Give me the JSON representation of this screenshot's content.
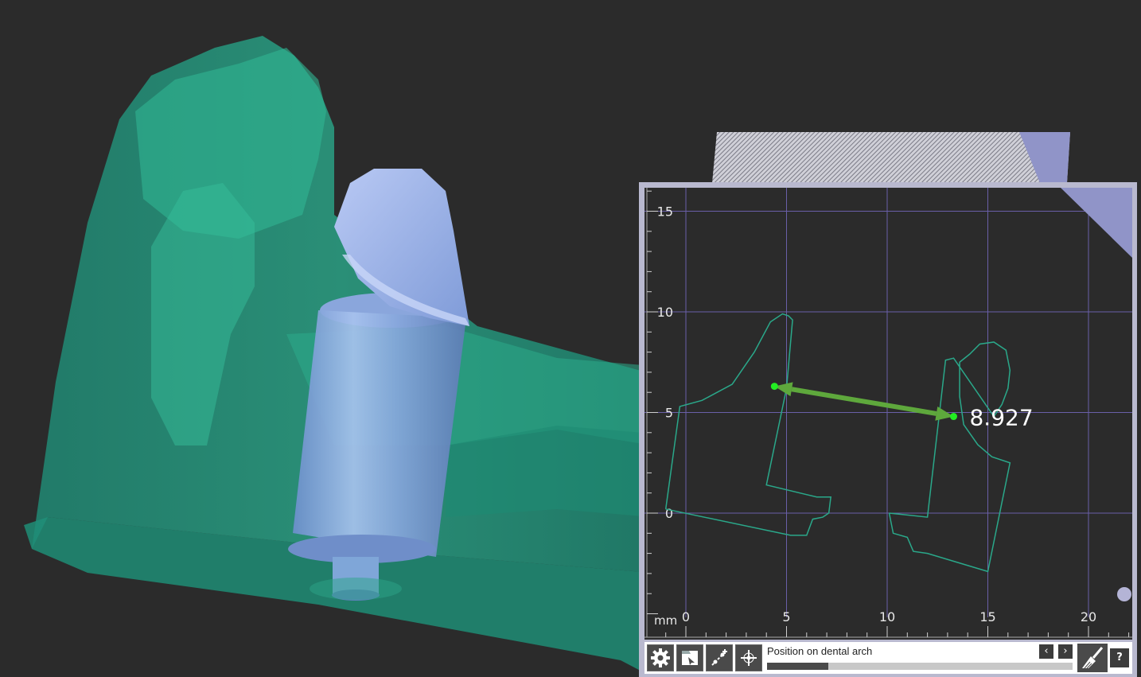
{
  "scene": {
    "model_color": "#2aa88a",
    "abutment_color": "#7f9fd8",
    "background_color": "#2b2b2b"
  },
  "chart_data": {
    "type": "cross-section",
    "unit_label": "mm",
    "x_ticks": [
      0,
      5,
      10,
      15,
      20
    ],
    "y_ticks": [
      0,
      5,
      10,
      15
    ],
    "xlim": [
      -1,
      23
    ],
    "ylim": [
      -5,
      16
    ],
    "grid": true,
    "outline_color": "#2aa88a",
    "measurement": {
      "label": "8.927",
      "start": [
        4.4,
        6.3
      ],
      "end": [
        13.3,
        4.8
      ],
      "color": "#5ea83c"
    },
    "outlines": [
      [
        [
          -1.0,
          0.2
        ],
        [
          -0.3,
          5.3
        ],
        [
          0.8,
          5.6
        ],
        [
          2.3,
          6.4
        ],
        [
          3.4,
          8.0
        ],
        [
          4.2,
          9.5
        ],
        [
          4.8,
          9.9
        ],
        [
          5.1,
          9.8
        ],
        [
          5.3,
          9.6
        ],
        [
          5.0,
          6.2
        ],
        [
          4.0,
          1.4
        ],
        [
          6.5,
          0.8
        ],
        [
          7.2,
          0.8
        ],
        [
          7.1,
          0.0
        ],
        [
          6.8,
          -0.2
        ],
        [
          6.3,
          -0.3
        ],
        [
          6.0,
          -1.1
        ],
        [
          5.2,
          -1.1
        ],
        [
          -1.0,
          0.2
        ]
      ],
      [
        [
          10.1,
          0.0
        ],
        [
          10.3,
          -1.0
        ],
        [
          11.0,
          -1.2
        ],
        [
          11.3,
          -1.9
        ],
        [
          12.0,
          -2.0
        ],
        [
          15.0,
          -2.9
        ],
        [
          16.1,
          2.5
        ],
        [
          15.2,
          2.8
        ],
        [
          14.5,
          3.4
        ],
        [
          13.8,
          4.4
        ],
        [
          13.6,
          5.8
        ],
        [
          13.6,
          7.5
        ],
        [
          14.1,
          7.9
        ],
        [
          14.6,
          8.4
        ],
        [
          15.3,
          8.5
        ],
        [
          15.9,
          8.1
        ],
        [
          16.1,
          7.1
        ],
        [
          16.0,
          6.2
        ],
        [
          15.7,
          5.4
        ],
        [
          15.3,
          4.8
        ],
        [
          13.3,
          7.7
        ],
        [
          12.9,
          7.6
        ],
        [
          12.0,
          -0.2
        ],
        [
          10.1,
          0.0
        ]
      ]
    ]
  },
  "toolbar": {
    "status_label": "Position on dental arch",
    "progress": 0.2,
    "prev_glyph": "‹",
    "next_glyph": "›",
    "help_label": "?",
    "icons": [
      "gear-icon",
      "tab-select-icon",
      "add-point-icon",
      "move-point-icon",
      "broom-icon"
    ]
  },
  "panel": {
    "frame_color": "#b9b9cf",
    "accent_color": "#9094c8"
  }
}
